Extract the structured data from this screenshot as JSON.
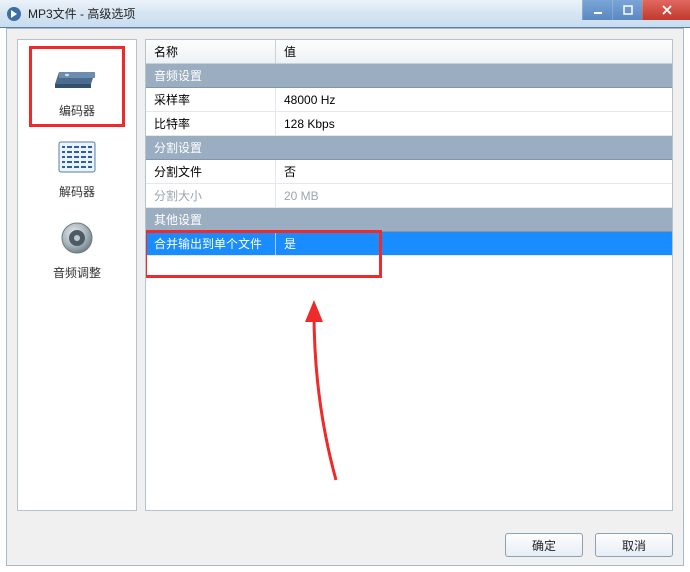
{
  "window": {
    "title": "MP3文件 - 高级选项"
  },
  "sidebar": {
    "items": [
      {
        "label": "编码器"
      },
      {
        "label": "解码器"
      },
      {
        "label": "音频调整"
      }
    ]
  },
  "grid": {
    "header_name": "名称",
    "header_value": "值",
    "section_audio": "音频设置",
    "sample_rate_label": "采样率",
    "sample_rate_value": "48000 Hz",
    "bitrate_label": "比特率",
    "bitrate_value": "128 Kbps",
    "section_split": "分割设置",
    "split_file_label": "分割文件",
    "split_file_value": "否",
    "split_size_label": "分割大小",
    "split_size_value": "20 MB",
    "section_other": "其他设置",
    "merge_label": "合并输出到单个文件",
    "merge_value": "是"
  },
  "buttons": {
    "ok": "确定",
    "cancel": "取消"
  }
}
